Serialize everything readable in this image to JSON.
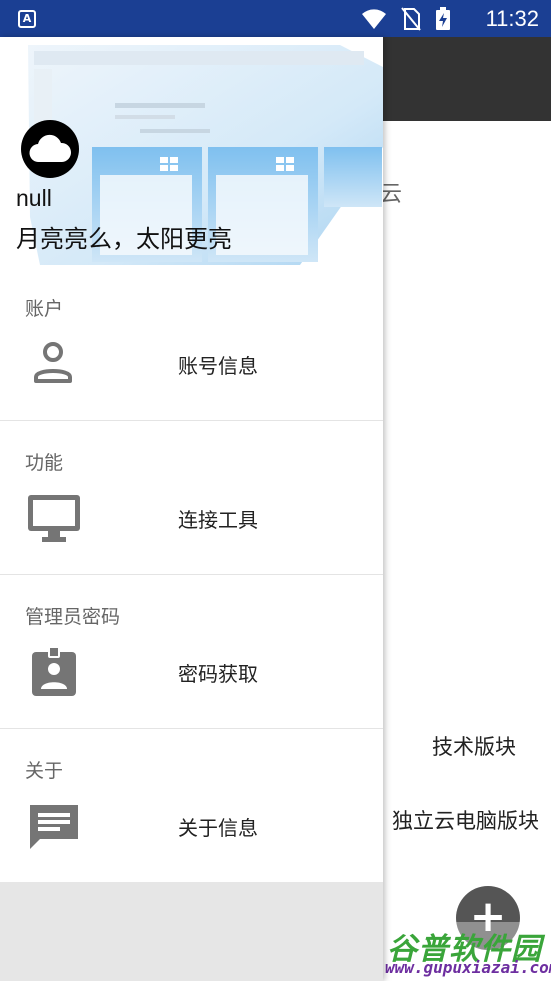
{
  "status_bar": {
    "app_icon_letter": "A",
    "time": "11:32"
  },
  "background_app": {
    "cloud_char": "云",
    "tech_section": "技术版块",
    "standalone_section": "独立云电脑版块",
    "fab_symbol": "+",
    "watermark_title": "谷普软件园",
    "watermark_url": "www.gupuxiazai.com"
  },
  "drawer": {
    "header": {
      "username": "null",
      "motto": "月亮亮么，太阳更亮"
    },
    "sections": [
      {
        "title": "账户",
        "item": {
          "label": "账号信息",
          "icon": "person-icon"
        }
      },
      {
        "title": "功能",
        "item": {
          "label": "连接工具",
          "icon": "monitor-icon"
        }
      },
      {
        "title": "管理员密码",
        "item": {
          "label": "密码获取",
          "icon": "badge-icon"
        }
      },
      {
        "title": "关于",
        "item": {
          "label": "关于信息",
          "icon": "message-icon"
        }
      }
    ]
  },
  "colors": {
    "status_bar": "#1b3f93",
    "toolbar": "#333333",
    "icon_gray": "#757575"
  }
}
